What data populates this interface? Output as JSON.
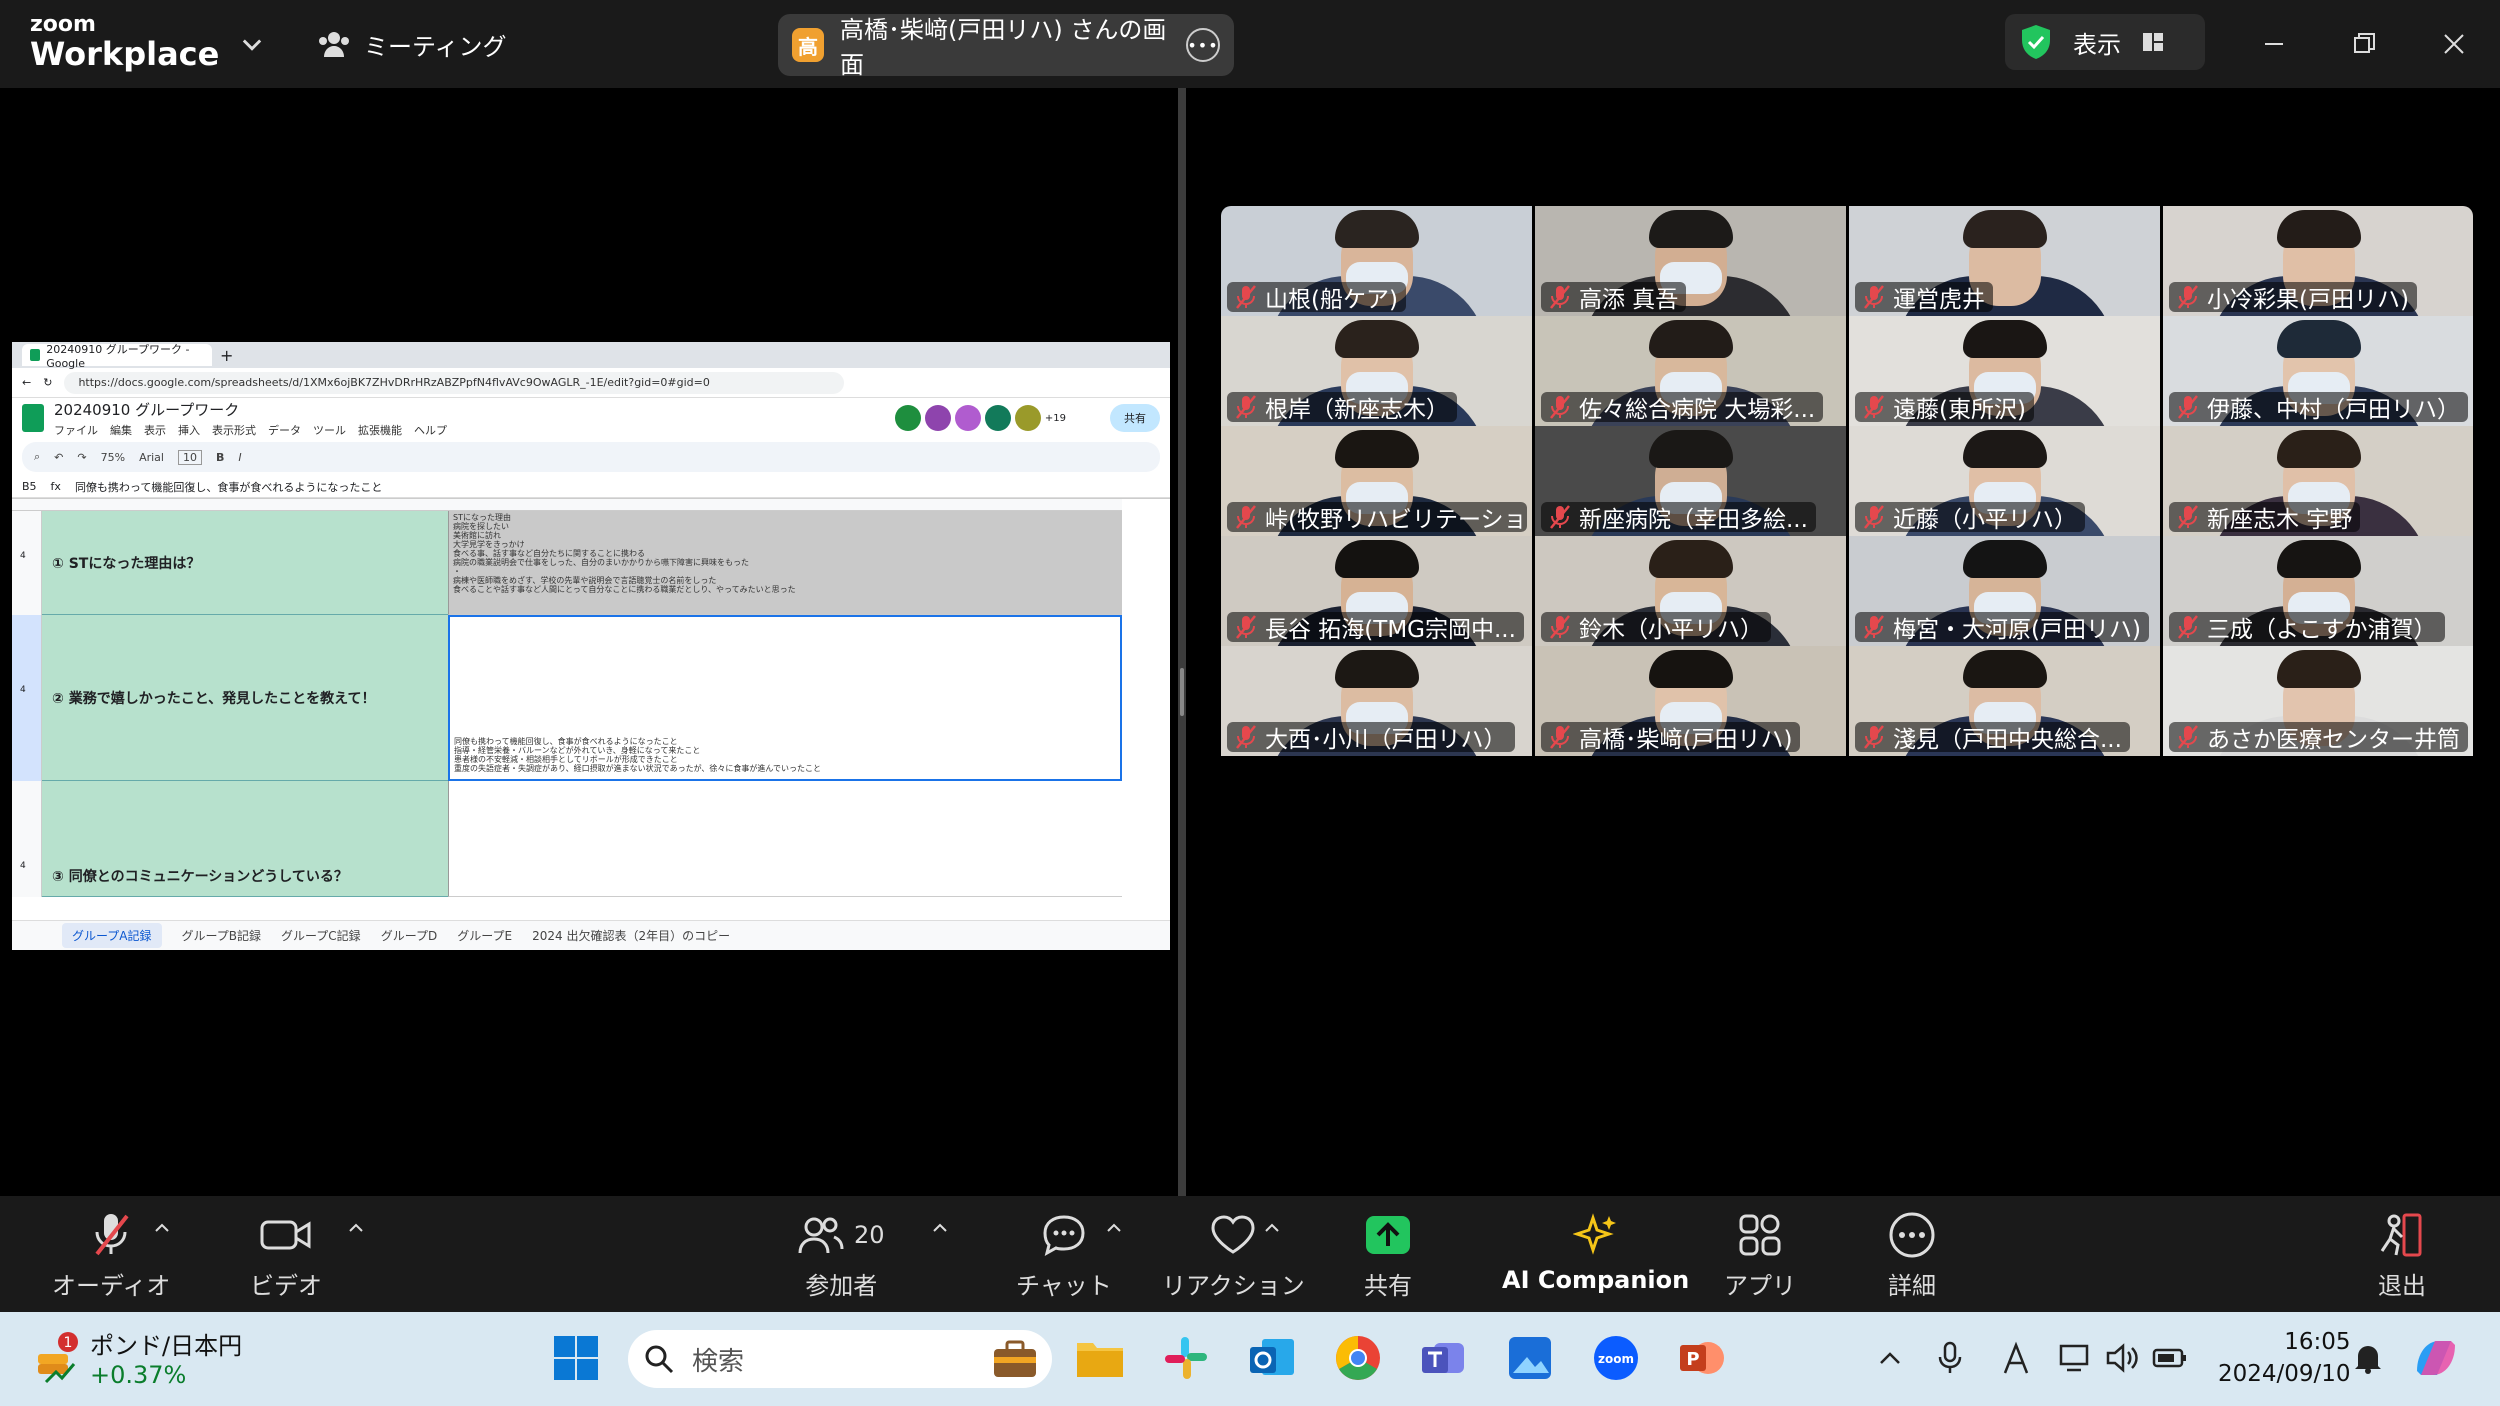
{
  "app": {
    "brand_line1": "zoom",
    "brand_line2": "Workplace",
    "meeting_menu": "ミーティング"
  },
  "share_pill": {
    "avatar_char": "高",
    "text": "高橋･柴﨑(戸田リハ) さんの画面"
  },
  "view_button": {
    "label": "表示"
  },
  "shared_screen": {
    "tab_title": "20240910 グループワーク - Google",
    "url": "https://docs.google.com/spreadsheets/d/1XMx6ojBK7ZHvDRrHRzABZPpfN4flvAVc9OwAGLR_-1E/edit?gid=0#gid=0",
    "doc_title": "20240910 グループワーク",
    "menus": [
      "ファイル",
      "編集",
      "表示",
      "挿入",
      "表示形式",
      "データ",
      "ツール",
      "拡張機能",
      "ヘルプ"
    ],
    "share_label": "共有",
    "collab_more": "+19",
    "toolbar": {
      "zoom": "75%",
      "font": "Arial",
      "size": "10"
    },
    "cell_ref": "B5",
    "formula": "同僚も携わって機能回復し、食事が食べれるようになったこと",
    "rows": [
      {
        "num": "4",
        "question": "① STになった理由は？",
        "answer": "STになった理由\n病院を探したい\n美術館に訪れ\n大学見学をきっかけ\n食べる事、話す事など自分たちに関することに携わる\n病院の職業説明会で仕事をしった、自分のまいかかりから嚥下障害に興味をもった\n・\n病棟や医師職をめざす、学校の先輩や説明会で言語聴覚士の名前をしった\n食べることや話す事など人間にとって自分なことに携わる職業だとしり、やってみたいと思った"
      },
      {
        "num": "4",
        "question": "② 業務で嬉しかったこと、発見したことを教えて！",
        "answer": "同僚も携わって機能回復し、食事が食べれるようになったこと\n指導・経管栄養・バルーンなどが外れていき、身軽になって来たこと\n患者様の不安軽減・相談相手としてリボールが形成できたこと\n重度の失語症者・失調症があり、経口摂取が進まない状況であったが、徐々に食事が進んでいったこと"
      },
      {
        "num": "4",
        "question": "③ 同僚とのコミュニケーションどうしている？",
        "answer": ""
      }
    ],
    "sheet_tabs": [
      "グループA記録",
      "グループB記録",
      "グループC記録",
      "グループD",
      "グループE",
      "2024 出欠確認表（2年目）のコピー"
    ]
  },
  "participants": [
    {
      "name": "山根(船ケア)",
      "bg": "#c9cfd6",
      "hair": "#2a2420",
      "skin": "#d9b59a",
      "body": "#3a4a6a",
      "mask": true
    },
    {
      "name": "高添 真吾",
      "bg": "#b9b6b0",
      "hair": "#1c1a18",
      "skin": "#d2ae92",
      "body": "#2c2c30",
      "mask": true
    },
    {
      "name": "運営虎井",
      "bg": "#cfd2d6",
      "hair": "#2a221e",
      "skin": "#dcbba2",
      "body": "#1f2a44",
      "mask": false
    },
    {
      "name": "小冷彩果(戸田リハ)",
      "bg": "#d7d3cf",
      "hair": "#231c18",
      "skin": "#e0bfa6",
      "body": "#2a3552",
      "mask": false
    },
    {
      "name": "根岸（新座志木）",
      "bg": "#d8d6d0",
      "hair": "#2a221c",
      "skin": "#e0c1a8",
      "body": "#2a3a5a",
      "mask": true
    },
    {
      "name": "佐々総合病院 大場彩...",
      "bg": "#c8c4b8",
      "hair": "#221c18",
      "skin": "#d8b89c",
      "body": "#3a4258",
      "mask": true
    },
    {
      "name": "遠藤(東所沢)",
      "bg": "#e2e0dc",
      "hair": "#1a1614",
      "skin": "#dcbaa0",
      "body": "#3a3c48",
      "mask": true
    },
    {
      "name": "伊藤、中村（戸田リハ）",
      "bg": "#d9dcdf",
      "hair": "#1e2a38",
      "skin": "#e2c4ac",
      "body": "#2c3a58",
      "mask": true
    },
    {
      "name": "峠(牧野リハビリテーショ...",
      "bg": "#d6cfc4",
      "hair": "#1a1612",
      "skin": "#dcbda2",
      "body": "#1e2a40",
      "mask": true
    },
    {
      "name": "新座病院（幸田多絵...",
      "bg": "#4a4a4a",
      "hair": "#1a1816",
      "skin": "#cfae94",
      "body": "#2a3a58",
      "mask": true
    },
    {
      "name": "近藤（小平リハ）",
      "bg": "#dedbd6",
      "hair": "#1c1816",
      "skin": "#e0bfa6",
      "body": "#3a4a6a",
      "mask": true
    },
    {
      "name": "新座志木 宇野",
      "bg": "#d4cfc6",
      "hair": "#2a2018",
      "skin": "#e0c0a8",
      "body": "#3a3040",
      "mask": true
    },
    {
      "name": "長谷 拓海(TMG宗岡中...",
      "bg": "#cfcac2",
      "hair": "#141210",
      "skin": "#d6b294",
      "body": "#1a2030",
      "mask": true
    },
    {
      "name": "鈴木（小平リハ）",
      "bg": "#cdc8c0",
      "hair": "#2a2018",
      "skin": "#d8b698",
      "body": "#2a2e38",
      "mask": true
    },
    {
      "name": "梅宮・大河原(戸田リハ)",
      "bg": "#c9ccd0",
      "hair": "#141414",
      "skin": "#d6b498",
      "body": "#2a3452",
      "mask": true
    },
    {
      "name": "三成（よこすか浦賀）",
      "bg": "#d0cfcc",
      "hair": "#161412",
      "skin": "#d4b094",
      "body": "#2a2a30",
      "mask": true
    },
    {
      "name": "大西･小川（戸田リハ）",
      "bg": "#d8d4ce",
      "hair": "#1c1814",
      "skin": "#dcbca2",
      "body": "#2c3650",
      "mask": true
    },
    {
      "name": "高橋･柴﨑(戸田リハ)",
      "bg": "#c9c2b6",
      "hair": "#161310",
      "skin": "#e0c2aa",
      "body": "#263048",
      "mask": true,
      "active": true
    },
    {
      "name": "淺見（戸田中央総合...",
      "bg": "#d4cec4",
      "hair": "#1a1612",
      "skin": "#dcbca4",
      "body": "#2a3656",
      "mask": true
    },
    {
      "name": "あさか医療センター井筒",
      "bg": "#e4e4e2",
      "hair": "#2a2018",
      "skin": "#e2c4ae",
      "body": "#dcdcdc",
      "mask": false
    }
  ],
  "controls": {
    "audio": "オーディオ",
    "video": "ビデオ",
    "participants": "参加者",
    "participant_count": "20",
    "chat": "チャット",
    "reactions": "リアクション",
    "share": "共有",
    "ai": "AI Companion",
    "apps": "アプリ",
    "more": "詳細",
    "leave": "退出"
  },
  "taskbar": {
    "ticker_name": "ポンド/日本円",
    "ticker_change": "+0.37%",
    "ticker_badge": "1",
    "search_placeholder": "検索",
    "time": "16:05",
    "date": "2024/09/10"
  },
  "colors": {
    "accent_green": "#22c55e",
    "zoom_blue": "#0b5cff",
    "mic_red": "#e5484d"
  }
}
